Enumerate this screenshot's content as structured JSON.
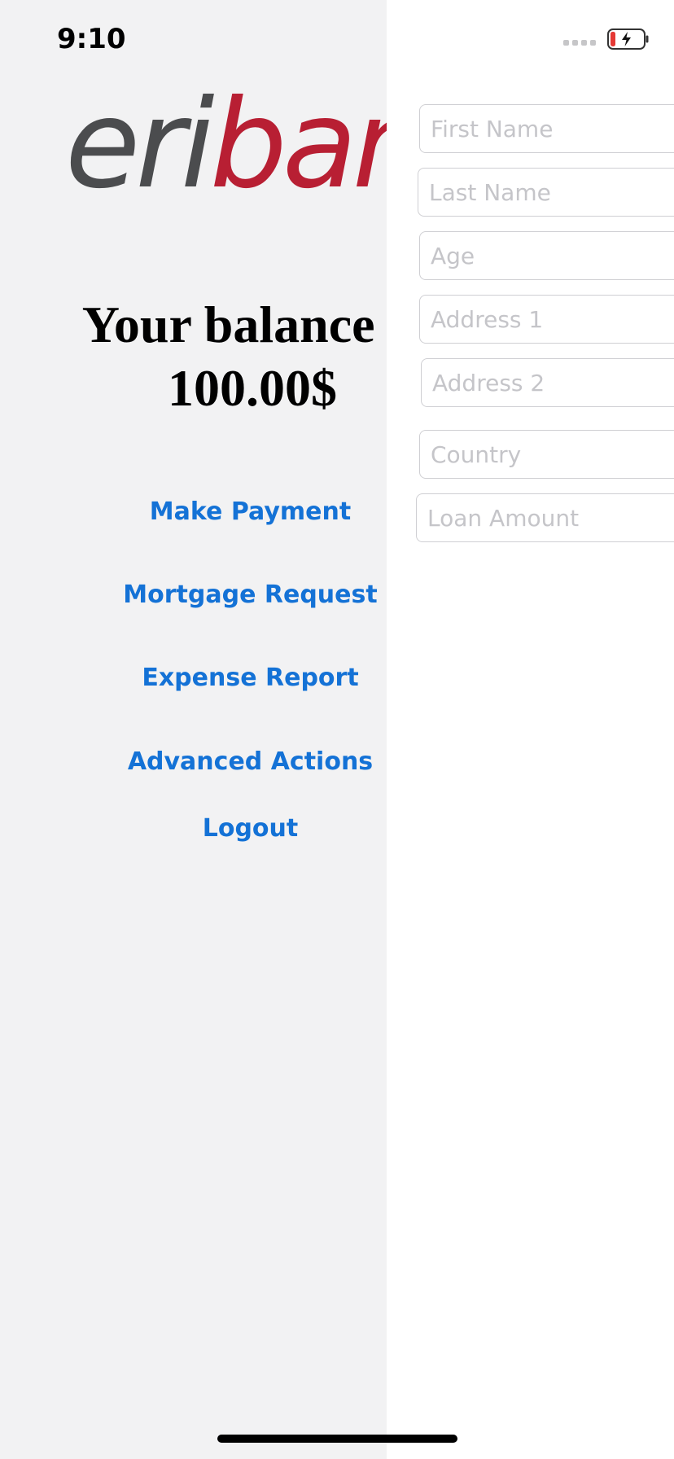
{
  "status_bar": {
    "time": "9:10",
    "battery_icon": "battery-charging-low-icon",
    "signal_icon": "signal-dots-icon"
  },
  "home": {
    "logo_grey": "eri",
    "logo_red": "bank",
    "balance_line1": "Your balance is",
    "balance_line2": "100.00$",
    "menu": {
      "make_payment": "Make Payment",
      "mortgage_request": "Mortgage Request",
      "expense_report": "Expense Report",
      "advanced_actions": "Advanced Actions",
      "logout": "Logout"
    }
  },
  "loan_form": {
    "first_name": {
      "placeholder": "First Name",
      "value": ""
    },
    "last_name": {
      "placeholder": "Last Name",
      "value": ""
    },
    "age": {
      "placeholder": "Age",
      "value": ""
    },
    "address1": {
      "placeholder": "Address 1",
      "value": ""
    },
    "address2": {
      "placeholder": "Address 2",
      "value": ""
    },
    "country": {
      "placeholder": "Country",
      "value": ""
    },
    "loan_amount": {
      "placeholder": "Loan Amount",
      "value": ""
    }
  },
  "colors": {
    "link_blue": "#1472d6",
    "brand_red": "#b81f33",
    "brand_grey": "#4b4c4e",
    "left_bg": "#f2f2f3"
  }
}
